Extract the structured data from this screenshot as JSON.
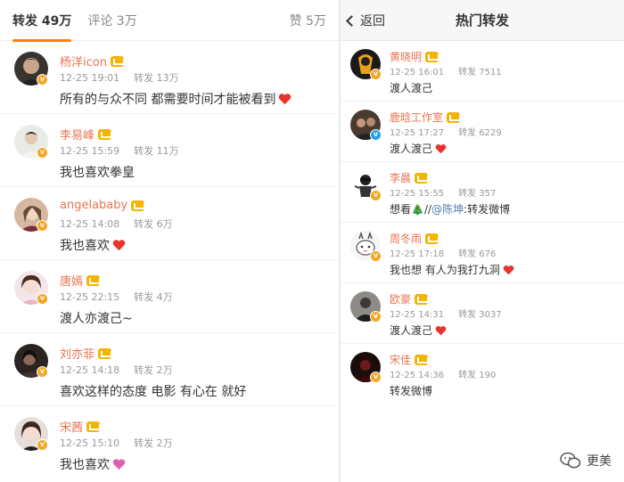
{
  "left": {
    "tabs": {
      "reposts": "转发 49万",
      "comments": "评论 3万",
      "likes": "赞 5万"
    },
    "items": [
      {
        "name": "杨洋icon",
        "time": "12-25 19:01",
        "reposts": "转发 13万",
        "text": "所有的与众不同 都需要时间才能被看到",
        "emoji": "heart"
      },
      {
        "name": "李易峰",
        "time": "12-25 15:59",
        "reposts": "转发 11万",
        "text": "我也喜欢拳皇",
        "emoji": ""
      },
      {
        "name": "angelababy",
        "time": "12-25 14:08",
        "reposts": "转发 6万",
        "text": "我也喜欢",
        "emoji": "heart"
      },
      {
        "name": "唐嫣",
        "time": "12-25 22:15",
        "reposts": "转发 4万",
        "text": "渡人亦渡己~",
        "emoji": ""
      },
      {
        "name": "刘亦菲",
        "time": "12-25 14:18",
        "reposts": "转发 2万",
        "text": "喜欢这样的态度 电影 有心在 就好",
        "emoji": ""
      },
      {
        "name": "宋茜",
        "time": "12-25 15:10",
        "reposts": "转发 2万",
        "text": "我也喜欢",
        "emoji": "pink-heart"
      }
    ]
  },
  "right": {
    "back_label": "返回",
    "title": "热门转发",
    "items": [
      {
        "name": "黄晓明",
        "time": "12-25 16:01",
        "reposts": "转发 7511",
        "text": "渡人渡己",
        "emoji": ""
      },
      {
        "name": "鹿晗工作室",
        "time": "12-25 17:27",
        "reposts": "转发 6229",
        "text": "渡人渡己",
        "emoji": "heart"
      },
      {
        "name": "李晨",
        "time": "12-25 15:55",
        "reposts": "转发 357",
        "text": "想看",
        "tree": "🎄",
        "mention_prefix": " //",
        "mention": "@陈坤",
        "mention_suffix": ":转发微博",
        "emoji": ""
      },
      {
        "name": "周冬雨",
        "time": "12-25 17:18",
        "reposts": "转发 676",
        "text": "我也想 有人为我打九洞",
        "emoji": "heart"
      },
      {
        "name": "欧豪",
        "time": "12-25 14:31",
        "reposts": "转发 3037",
        "text": "渡人渡己",
        "emoji": "heart"
      },
      {
        "name": "宋佳",
        "time": "12-25 14:36",
        "reposts": "转发 190",
        "text": "转发微博",
        "emoji": ""
      }
    ]
  },
  "watermark": "更美",
  "colors": {
    "username": "#eb7350",
    "tab_indicator": "#ff8200",
    "heart": "#e8332e",
    "pink_heart": "#e060b8",
    "mention": "#507daf"
  }
}
